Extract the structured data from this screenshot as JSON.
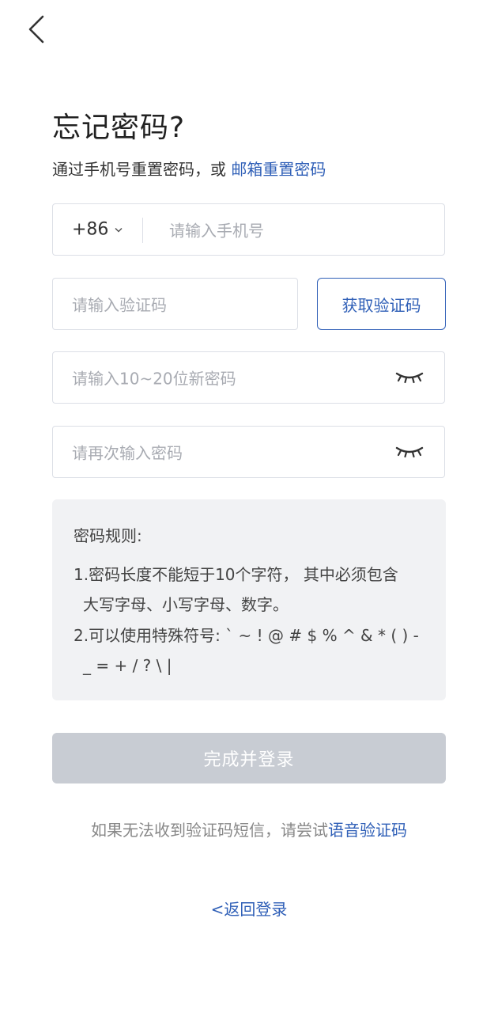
{
  "header": {
    "back_icon": "chevron-left-icon"
  },
  "title": "忘记密码?",
  "subtitle": {
    "text": "通过手机号重置密码，或 ",
    "link": "邮箱重置密码"
  },
  "phone": {
    "country_code": "+86",
    "chevron": "⌄",
    "placeholder": "请输入手机号"
  },
  "code": {
    "placeholder": "请输入验证码",
    "button_label": "获取验证码"
  },
  "password": {
    "placeholder": "请输入10~20位新密码",
    "eye_icon": "eye-closed-icon"
  },
  "confirm_password": {
    "placeholder": "请再次输入密码",
    "eye_icon": "eye-closed-icon"
  },
  "rules": {
    "title": "密码规则:",
    "rule1_line1": "1.密码长度不能短于10个字符， 其中必须包含",
    "rule1_line2": "大写字母、小写字母、数字。",
    "rule2_line1": "2.可以使用特殊符号: ` ~ ! @ # $ % ^ & * ( ) -",
    "rule2_line2": "_ = + / ? \\ |"
  },
  "submit_label": "完成并登录",
  "voice_hint": {
    "text": "如果无法收到验证码短信，请尝试",
    "link": "语音验证码"
  },
  "back_login": "<返回登录",
  "colors": {
    "accent": "#2f5fb7",
    "disabled_button": "#c8ccd3",
    "rules_bg": "#f1f2f4",
    "placeholder": "#a8abb2",
    "border": "#dcdfe6"
  }
}
